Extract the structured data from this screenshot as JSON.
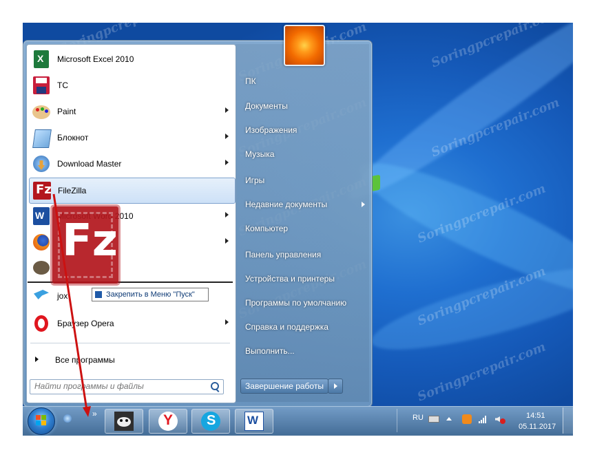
{
  "left_programs": [
    {
      "label": "Microsoft Excel 2010",
      "icon": "excel-icon",
      "arrow": false
    },
    {
      "label": "TC",
      "icon": "floppy-disk-icon",
      "arrow": false
    },
    {
      "label": "Paint",
      "icon": "paint-palette-icon",
      "arrow": true
    },
    {
      "label": "Блокнот",
      "icon": "notepad-icon",
      "arrow": true
    },
    {
      "label": "Download Master",
      "icon": "download-master-icon",
      "arrow": true
    },
    {
      "label": "FileZilla",
      "icon": "filezilla-icon",
      "arrow": false,
      "selected": true
    },
    {
      "label": "Microsoft Word 2010",
      "icon": "word-icon",
      "arrow": true
    },
    {
      "label": "",
      "icon": "firefox-icon",
      "arrow": true
    },
    {
      "label": "",
      "icon": "gimp-icon",
      "arrow": false
    },
    {
      "label": "jox",
      "icon": "bird-icon",
      "arrow": false
    },
    {
      "label": "Браузер Opera",
      "icon": "opera-icon",
      "arrow": true
    }
  ],
  "all_programs_label": "Все программы",
  "search": {
    "placeholder": "Найти программы и файлы"
  },
  "tooltip": {
    "label": "Закрепить в Меню \"Пуск\""
  },
  "right_items": [
    {
      "label": "ПК",
      "arrow": false
    },
    {
      "label": "Документы",
      "arrow": false
    },
    {
      "label": "Изображения",
      "arrow": false
    },
    {
      "label": "Музыка",
      "arrow": false
    },
    {
      "label": "Игры",
      "arrow": false
    },
    {
      "label": "Недавние документы",
      "arrow": true
    },
    {
      "label": "Компьютер",
      "arrow": false
    },
    {
      "label": "Панель управления",
      "arrow": false
    },
    {
      "label": "Устройства и принтеры",
      "arrow": false
    },
    {
      "label": "Программы по умолчанию",
      "arrow": false
    },
    {
      "label": "Справка и поддержка",
      "arrow": false
    },
    {
      "label": "Выполнить...",
      "arrow": false
    }
  ],
  "shutdown_label": "Завершение работы",
  "taskbar": {
    "pinned": [
      "panda-icon",
      "yandex-browser-icon",
      "skype-icon",
      "word-icon"
    ],
    "language": "RU",
    "time": "14:51",
    "date": "05.11.2017"
  },
  "watermark": "Soringpcrepair.com",
  "colors": {
    "arrow": "#cc1111",
    "desktop": "#1f6fd0"
  }
}
